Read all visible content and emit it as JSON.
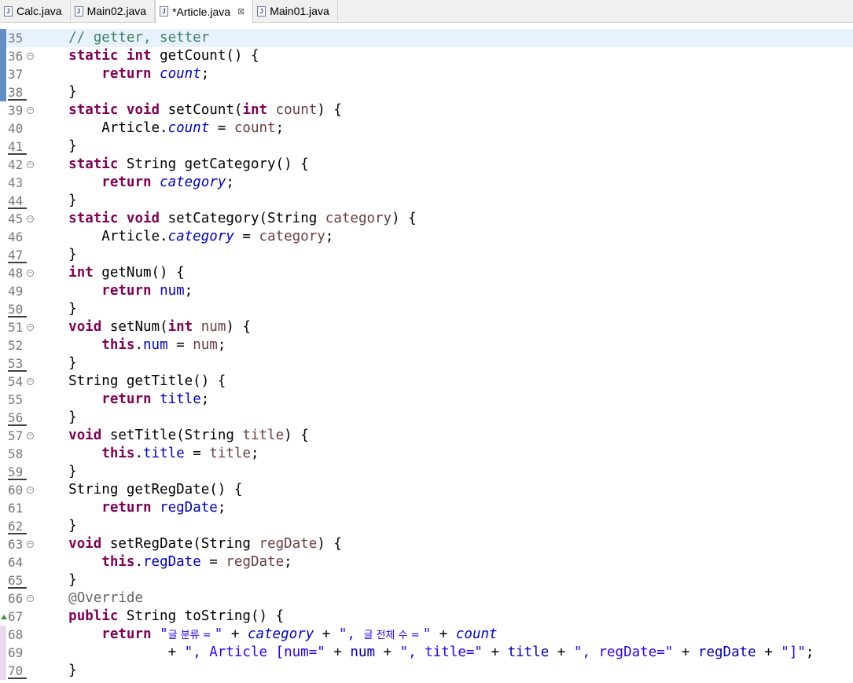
{
  "tabs": [
    {
      "label": "Calc.java",
      "active": false,
      "closable": false
    },
    {
      "label": "Main02.java",
      "active": false,
      "closable": false
    },
    {
      "label": "*Article.java",
      "active": true,
      "closable": true
    },
    {
      "label": "Main01.java",
      "active": false,
      "closable": false
    }
  ],
  "editor": {
    "current_line": "35",
    "lines": [
      {
        "num": "35",
        "fold": false,
        "mod": false,
        "bar": "blue",
        "tokens": [
          [
            "    // getter, setter",
            "cm"
          ]
        ]
      },
      {
        "num": "36",
        "fold": true,
        "mod": false,
        "bar": "blue",
        "tokens": [
          [
            "    ",
            ""
          ],
          [
            "static",
            "kw"
          ],
          [
            " ",
            ""
          ],
          [
            "int",
            "kw"
          ],
          [
            " getCount() {",
            ""
          ]
        ]
      },
      {
        "num": "37",
        "fold": false,
        "mod": false,
        "bar": "blue",
        "tokens": [
          [
            "        ",
            ""
          ],
          [
            "return",
            "kw"
          ],
          [
            " ",
            ""
          ],
          [
            "count",
            "sfld"
          ],
          [
            ";",
            ""
          ]
        ]
      },
      {
        "num": "38",
        "fold": false,
        "mod": true,
        "bar": "blue",
        "tokens": [
          [
            "    }",
            ""
          ]
        ]
      },
      {
        "num": "39",
        "fold": true,
        "mod": false,
        "bar": "",
        "tokens": [
          [
            "    ",
            ""
          ],
          [
            "static",
            "kw"
          ],
          [
            " ",
            ""
          ],
          [
            "void",
            "kw"
          ],
          [
            " setCount(",
            ""
          ],
          [
            "int",
            "kw"
          ],
          [
            " ",
            ""
          ],
          [
            "count",
            "prm"
          ],
          [
            ") {",
            ""
          ]
        ]
      },
      {
        "num": "40",
        "fold": false,
        "mod": false,
        "bar": "",
        "tokens": [
          [
            "        Article.",
            ""
          ],
          [
            "count",
            "sfld"
          ],
          [
            " = ",
            ""
          ],
          [
            "count",
            "prm"
          ],
          [
            ";",
            ""
          ]
        ]
      },
      {
        "num": "41",
        "fold": false,
        "mod": true,
        "bar": "",
        "tokens": [
          [
            "    }",
            ""
          ]
        ]
      },
      {
        "num": "42",
        "fold": true,
        "mod": false,
        "bar": "",
        "tokens": [
          [
            "    ",
            ""
          ],
          [
            "static",
            "kw"
          ],
          [
            " String getCategory() {",
            ""
          ]
        ]
      },
      {
        "num": "43",
        "fold": false,
        "mod": false,
        "bar": "",
        "tokens": [
          [
            "        ",
            ""
          ],
          [
            "return",
            "kw"
          ],
          [
            " ",
            ""
          ],
          [
            "category",
            "sfld"
          ],
          [
            ";",
            ""
          ]
        ]
      },
      {
        "num": "44",
        "fold": false,
        "mod": true,
        "bar": "",
        "tokens": [
          [
            "    }",
            ""
          ]
        ]
      },
      {
        "num": "45",
        "fold": true,
        "mod": false,
        "bar": "",
        "tokens": [
          [
            "    ",
            ""
          ],
          [
            "static",
            "kw"
          ],
          [
            " ",
            ""
          ],
          [
            "void",
            "kw"
          ],
          [
            " setCategory(String ",
            ""
          ],
          [
            "category",
            "prm"
          ],
          [
            ") {",
            ""
          ]
        ]
      },
      {
        "num": "46",
        "fold": false,
        "mod": false,
        "bar": "",
        "tokens": [
          [
            "        Article.",
            ""
          ],
          [
            "category",
            "sfld"
          ],
          [
            " = ",
            ""
          ],
          [
            "category",
            "prm"
          ],
          [
            ";",
            ""
          ]
        ]
      },
      {
        "num": "47",
        "fold": false,
        "mod": true,
        "bar": "",
        "tokens": [
          [
            "    }",
            ""
          ]
        ]
      },
      {
        "num": "48",
        "fold": true,
        "mod": false,
        "bar": "",
        "tokens": [
          [
            "    ",
            ""
          ],
          [
            "int",
            "kw"
          ],
          [
            " getNum() {",
            ""
          ]
        ]
      },
      {
        "num": "49",
        "fold": false,
        "mod": false,
        "bar": "",
        "tokens": [
          [
            "        ",
            ""
          ],
          [
            "return",
            "kw"
          ],
          [
            " ",
            ""
          ],
          [
            "num",
            "fld"
          ],
          [
            ";",
            ""
          ]
        ]
      },
      {
        "num": "50",
        "fold": false,
        "mod": true,
        "bar": "",
        "tokens": [
          [
            "    }",
            ""
          ]
        ]
      },
      {
        "num": "51",
        "fold": true,
        "mod": false,
        "bar": "",
        "tokens": [
          [
            "    ",
            ""
          ],
          [
            "void",
            "kw"
          ],
          [
            " setNum(",
            ""
          ],
          [
            "int",
            "kw"
          ],
          [
            " ",
            ""
          ],
          [
            "num",
            "prm"
          ],
          [
            ") {",
            ""
          ]
        ]
      },
      {
        "num": "52",
        "fold": false,
        "mod": false,
        "bar": "",
        "tokens": [
          [
            "        ",
            ""
          ],
          [
            "this",
            "kw"
          ],
          [
            ".",
            ""
          ],
          [
            "num",
            "fld"
          ],
          [
            " = ",
            ""
          ],
          [
            "num",
            "prm"
          ],
          [
            ";",
            ""
          ]
        ]
      },
      {
        "num": "53",
        "fold": false,
        "mod": true,
        "bar": "",
        "tokens": [
          [
            "    }",
            ""
          ]
        ]
      },
      {
        "num": "54",
        "fold": true,
        "mod": false,
        "bar": "",
        "tokens": [
          [
            "    String getTitle() {",
            ""
          ]
        ]
      },
      {
        "num": "55",
        "fold": false,
        "mod": false,
        "bar": "",
        "tokens": [
          [
            "        ",
            ""
          ],
          [
            "return",
            "kw"
          ],
          [
            " ",
            ""
          ],
          [
            "title",
            "fld"
          ],
          [
            ";",
            ""
          ]
        ]
      },
      {
        "num": "56",
        "fold": false,
        "mod": true,
        "bar": "",
        "tokens": [
          [
            "    }",
            ""
          ]
        ]
      },
      {
        "num": "57",
        "fold": true,
        "mod": false,
        "bar": "",
        "tokens": [
          [
            "    ",
            ""
          ],
          [
            "void",
            "kw"
          ],
          [
            " setTitle(String ",
            ""
          ],
          [
            "title",
            "prm"
          ],
          [
            ") {",
            ""
          ]
        ]
      },
      {
        "num": "58",
        "fold": false,
        "mod": false,
        "bar": "",
        "tokens": [
          [
            "        ",
            ""
          ],
          [
            "this",
            "kw"
          ],
          [
            ".",
            ""
          ],
          [
            "title",
            "fld"
          ],
          [
            " = ",
            ""
          ],
          [
            "title",
            "prm"
          ],
          [
            ";",
            ""
          ]
        ]
      },
      {
        "num": "59",
        "fold": false,
        "mod": true,
        "bar": "",
        "tokens": [
          [
            "    }",
            ""
          ]
        ]
      },
      {
        "num": "60",
        "fold": true,
        "mod": false,
        "bar": "",
        "tokens": [
          [
            "    String getRegDate() {",
            ""
          ]
        ]
      },
      {
        "num": "61",
        "fold": false,
        "mod": false,
        "bar": "",
        "tokens": [
          [
            "        ",
            ""
          ],
          [
            "return",
            "kw"
          ],
          [
            " ",
            ""
          ],
          [
            "regDate",
            "fld"
          ],
          [
            ";",
            ""
          ]
        ]
      },
      {
        "num": "62",
        "fold": false,
        "mod": true,
        "bar": "",
        "tokens": [
          [
            "    }",
            ""
          ]
        ]
      },
      {
        "num": "63",
        "fold": true,
        "mod": false,
        "bar": "",
        "tokens": [
          [
            "    ",
            ""
          ],
          [
            "void",
            "kw"
          ],
          [
            " setRegDate(String ",
            ""
          ],
          [
            "regDate",
            "prm"
          ],
          [
            ") {",
            ""
          ]
        ]
      },
      {
        "num": "64",
        "fold": false,
        "mod": false,
        "bar": "",
        "tokens": [
          [
            "        ",
            ""
          ],
          [
            "this",
            "kw"
          ],
          [
            ".",
            ""
          ],
          [
            "regDate",
            "fld"
          ],
          [
            " = ",
            ""
          ],
          [
            "regDate",
            "prm"
          ],
          [
            ";",
            ""
          ]
        ]
      },
      {
        "num": "65",
        "fold": false,
        "mod": true,
        "bar": "",
        "tokens": [
          [
            "    }",
            ""
          ]
        ]
      },
      {
        "num": "66",
        "fold": true,
        "mod": false,
        "bar": "",
        "tokens": [
          [
            "    ",
            ""
          ],
          [
            "@Override",
            "ann"
          ]
        ]
      },
      {
        "num": "67",
        "fold": false,
        "mod": false,
        "bar": "",
        "override": true,
        "tokens": [
          [
            "    ",
            ""
          ],
          [
            "public",
            "kw"
          ],
          [
            " String toString() {",
            ""
          ]
        ]
      },
      {
        "num": "68",
        "fold": false,
        "mod": false,
        "bar": "purple",
        "tokens": [
          [
            "        ",
            ""
          ],
          [
            "return",
            "kw"
          ],
          [
            " ",
            ""
          ],
          [
            "\"",
            "str"
          ],
          [
            "글 분류 = ",
            "str ko"
          ],
          [
            "\"",
            "str"
          ],
          [
            " + ",
            ""
          ],
          [
            "category",
            "sfld"
          ],
          [
            " + ",
            ""
          ],
          [
            "\", ",
            "str"
          ],
          [
            "글 전체 수 = ",
            "str ko"
          ],
          [
            "\"",
            "str"
          ],
          [
            " + ",
            ""
          ],
          [
            "count",
            "sfld"
          ]
        ]
      },
      {
        "num": "69",
        "fold": false,
        "mod": false,
        "bar": "purple",
        "tokens": [
          [
            "                + ",
            ""
          ],
          [
            "\", Article [num=\"",
            "str"
          ],
          [
            " + ",
            ""
          ],
          [
            "num",
            "fld"
          ],
          [
            " + ",
            ""
          ],
          [
            "\", title=\"",
            "str"
          ],
          [
            " + ",
            ""
          ],
          [
            "title",
            "fld"
          ],
          [
            " + ",
            ""
          ],
          [
            "\", regDate=\"",
            "str"
          ],
          [
            " + ",
            ""
          ],
          [
            "regDate",
            "fld"
          ],
          [
            " + ",
            ""
          ],
          [
            "\"]\"",
            "str"
          ],
          [
            ";",
            ""
          ]
        ]
      },
      {
        "num": "70",
        "fold": false,
        "mod": true,
        "bar": "purple",
        "tokens": [
          [
            "    }",
            ""
          ]
        ]
      }
    ]
  },
  "colors": {
    "keyword": "#7f0055",
    "comment": "#3f7f5f",
    "field": "#0000c0",
    "parameter": "#6a3e3e",
    "string": "#2a00ff",
    "annotation": "#646464",
    "current_line_bg": "#e8f2fe"
  },
  "icons": {
    "file": "java-file-icon",
    "close": "close-icon",
    "fold": "fold-collapse-icon",
    "override": "override-marker-icon"
  }
}
